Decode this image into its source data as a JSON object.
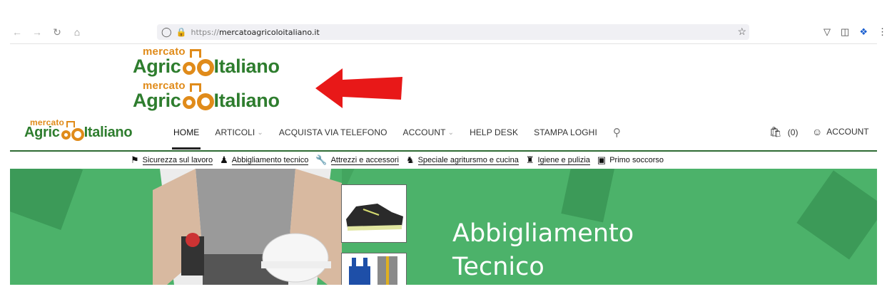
{
  "browser": {
    "url_proto": "https://",
    "url_host": "mercatoagricoloitaliano.it"
  },
  "logo": {
    "small": "mercato",
    "agri": "Agric",
    "ital": "Italiano"
  },
  "nav": {
    "home": "HOME",
    "articoli": "ARTICOLI",
    "acquista": "ACQUISTA VIA TELEFONO",
    "account": "ACCOUNT",
    "helpdesk": "HELP DESK",
    "stampa": "STAMPA LOGHI",
    "cart_count": "(0)",
    "account_right": "ACCOUNT"
  },
  "categories": [
    {
      "label": "Sicurezza sul lavoro",
      "icon": "helmet-icon"
    },
    {
      "label": "Abbigliamento tecnico",
      "icon": "users-icon"
    },
    {
      "label": "Attrezzi e accessori",
      "icon": "wrench-icon"
    },
    {
      "label": "Speciale agritursmo e cucina",
      "icon": "chef-icon"
    },
    {
      "label": "Igiene e pulizia",
      "icon": "cleaning-icon"
    },
    {
      "label": "Primo soccorso",
      "icon": "first-aid-icon"
    }
  ],
  "hero": {
    "title_line1": "Abbigliamento",
    "title_line2": "Tecnico"
  },
  "colors": {
    "hero_green": "#4cb26a",
    "logo_green": "#2e7d2e",
    "logo_orange": "#e08b1a",
    "arrow_red": "#e81818"
  }
}
